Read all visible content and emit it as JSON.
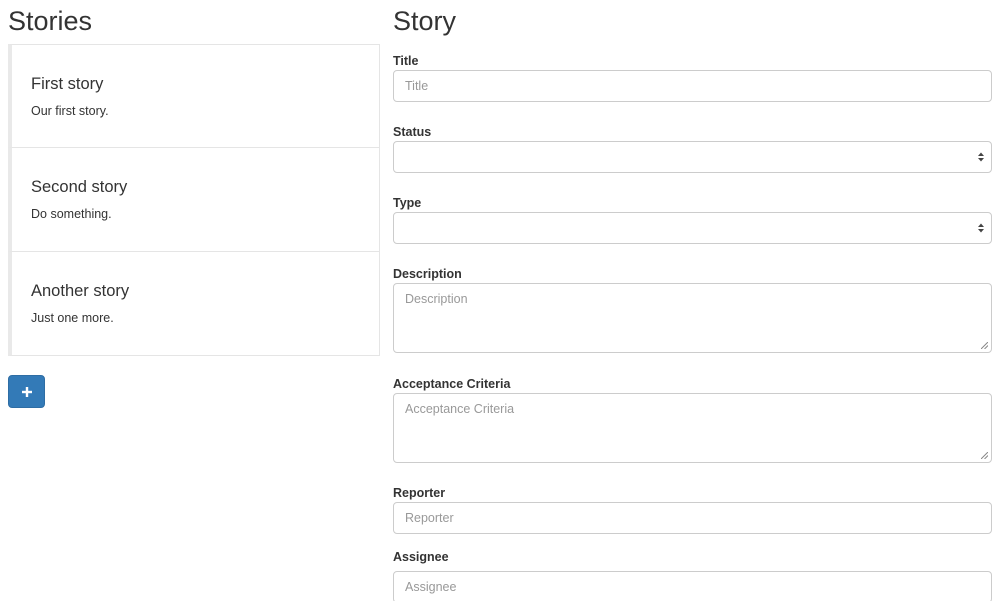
{
  "stories_panel": {
    "heading": "Stories",
    "items": [
      {
        "title": "First story",
        "description": "Our first story."
      },
      {
        "title": "Second story",
        "description": "Do something."
      },
      {
        "title": "Another story",
        "description": "Just one more."
      }
    ],
    "add_button_icon": "plus-icon"
  },
  "story_form": {
    "heading": "Story",
    "title": {
      "label": "Title",
      "placeholder": "Title",
      "value": ""
    },
    "status": {
      "label": "Status",
      "value": ""
    },
    "type": {
      "label": "Type",
      "value": ""
    },
    "description": {
      "label": "Description",
      "placeholder": "Description",
      "value": ""
    },
    "acceptance_criteria": {
      "label": "Acceptance Criteria",
      "placeholder": "Acceptance Criteria",
      "value": ""
    },
    "reporter": {
      "label": "Reporter",
      "placeholder": "Reporter",
      "value": ""
    },
    "assignee": {
      "label": "Assignee",
      "placeholder": "Assignee",
      "value": ""
    }
  },
  "colors": {
    "primary_button": "#337ab7",
    "input_border": "#cccccc",
    "text": "#333333",
    "placeholder": "#999999"
  }
}
